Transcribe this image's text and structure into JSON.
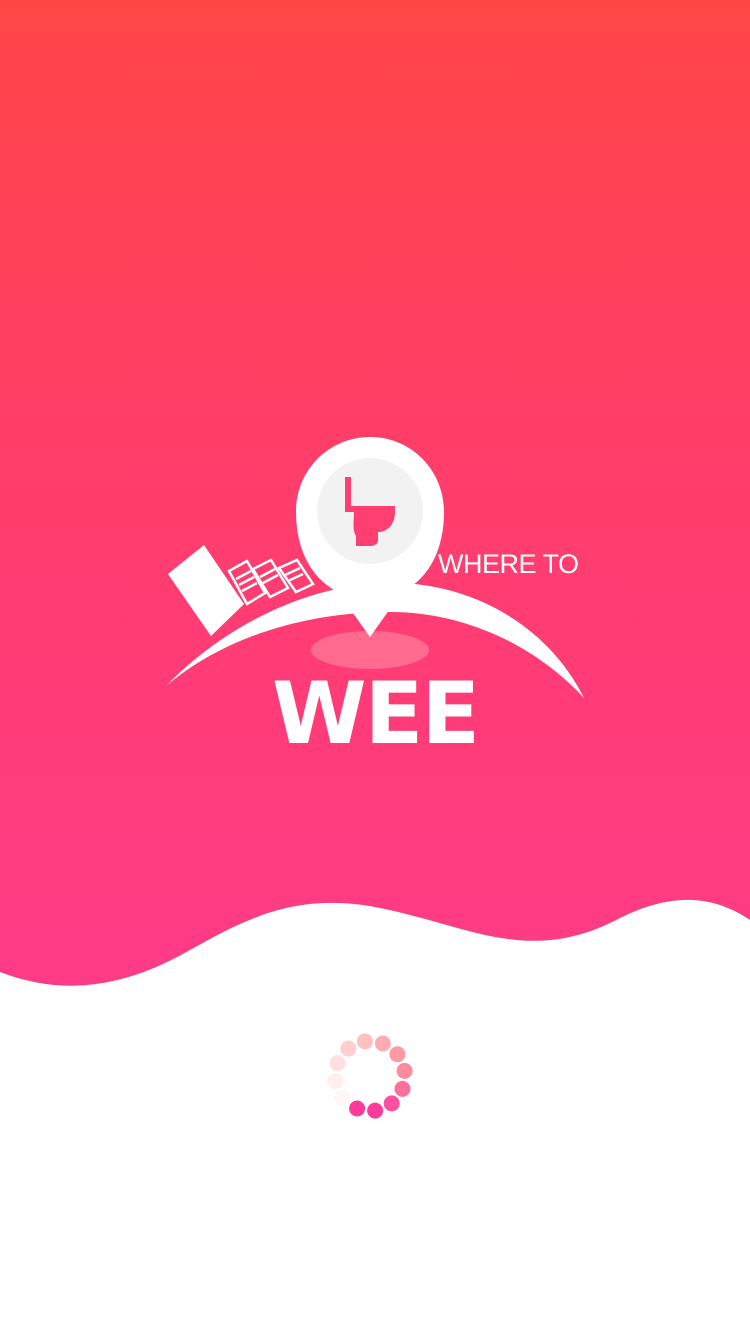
{
  "splash": {
    "tagline": "WHERE TO",
    "brand": "WEE"
  },
  "logo": {
    "pin_icon": "toilet-pin-icon",
    "buildings_icon": "city-buildings-icon"
  },
  "loader": {
    "icon": "loading-spinner-icon",
    "dot_colors": [
      "#ff3b9a",
      "#ff3b9a",
      "#ff4fa0",
      "#ff6f9d",
      "#ff8a9e",
      "#ff9aa5",
      "#ffadb0",
      "#ffc0c0",
      "#ffcfcf",
      "#ffe0e0",
      "#fff0f0",
      "#fff6f6"
    ]
  },
  "colors": {
    "gradient_top": "#ff4647",
    "gradient_bottom": "#ff3b88",
    "accent": "#ff3b71",
    "background": "#ffffff"
  }
}
